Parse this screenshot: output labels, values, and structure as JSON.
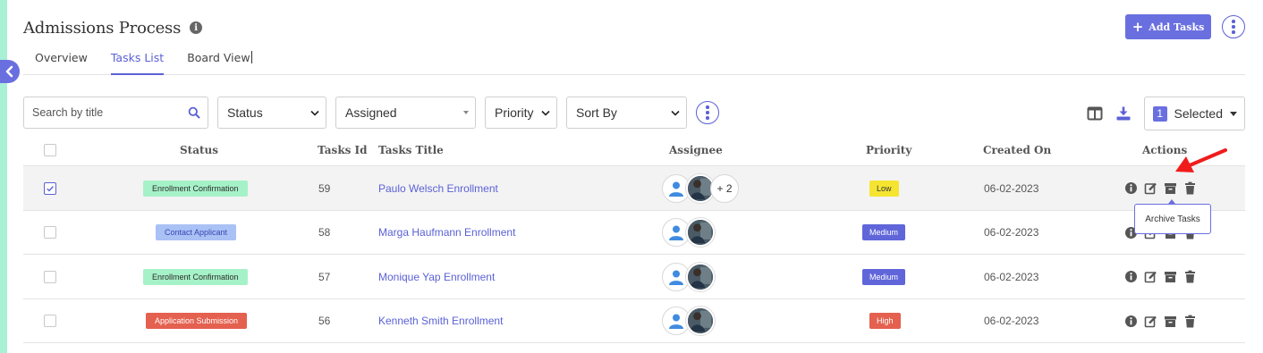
{
  "page": {
    "title": "Admissions Process"
  },
  "tabs": [
    {
      "label": "Overview",
      "active": false
    },
    {
      "label": "Tasks List",
      "active": true
    },
    {
      "label": "Board View",
      "active": false
    }
  ],
  "header_actions": {
    "add_label": "Add Tasks",
    "add_icon": "plus-icon"
  },
  "filters": {
    "search_placeholder": "Search by title",
    "status_label": "Status",
    "assigned_label": "Assigned",
    "priority_label": "Priority",
    "sort_label": "Sort By"
  },
  "toolbar": {
    "selected_count": "1",
    "selected_label": "Selected"
  },
  "columns": {
    "status": "Status",
    "task_id": "Tasks Id",
    "title": "Tasks Title",
    "assignee": "Assignee",
    "priority": "Priority",
    "created": "Created On",
    "actions": "Actions"
  },
  "rows": [
    {
      "checked": true,
      "status": "Enrollment Confirmation",
      "id": "59",
      "title": "Paulo Welsch Enrollment",
      "more": "+ 2",
      "priority": "Low",
      "created": "06-02-2023"
    },
    {
      "checked": false,
      "status": "Contact Applicant",
      "id": "58",
      "title": "Marga Haufmann Enrollment",
      "more": "",
      "priority": "Medium",
      "created": "06-02-2023"
    },
    {
      "checked": false,
      "status": "Enrollment Confirmation",
      "id": "57",
      "title": "Monique Yap Enrollment",
      "more": "",
      "priority": "Medium",
      "created": "06-02-2023"
    },
    {
      "checked": false,
      "status": "Application Submission",
      "id": "56",
      "title": "Kenneth Smith Enrollment",
      "more": "",
      "priority": "High",
      "created": "06-02-2023"
    }
  ],
  "tooltip": {
    "text": "Archive Tasks"
  },
  "colors": {
    "accent": "#5b61d6",
    "status_enrollment_confirmation": "#a6f2c8",
    "status_contact_applicant": "#a9c1f5",
    "status_application_submission": "#e4604f",
    "priority_low": "#f5e531",
    "priority_medium": "#6066d9",
    "priority_high": "#e4604f"
  }
}
